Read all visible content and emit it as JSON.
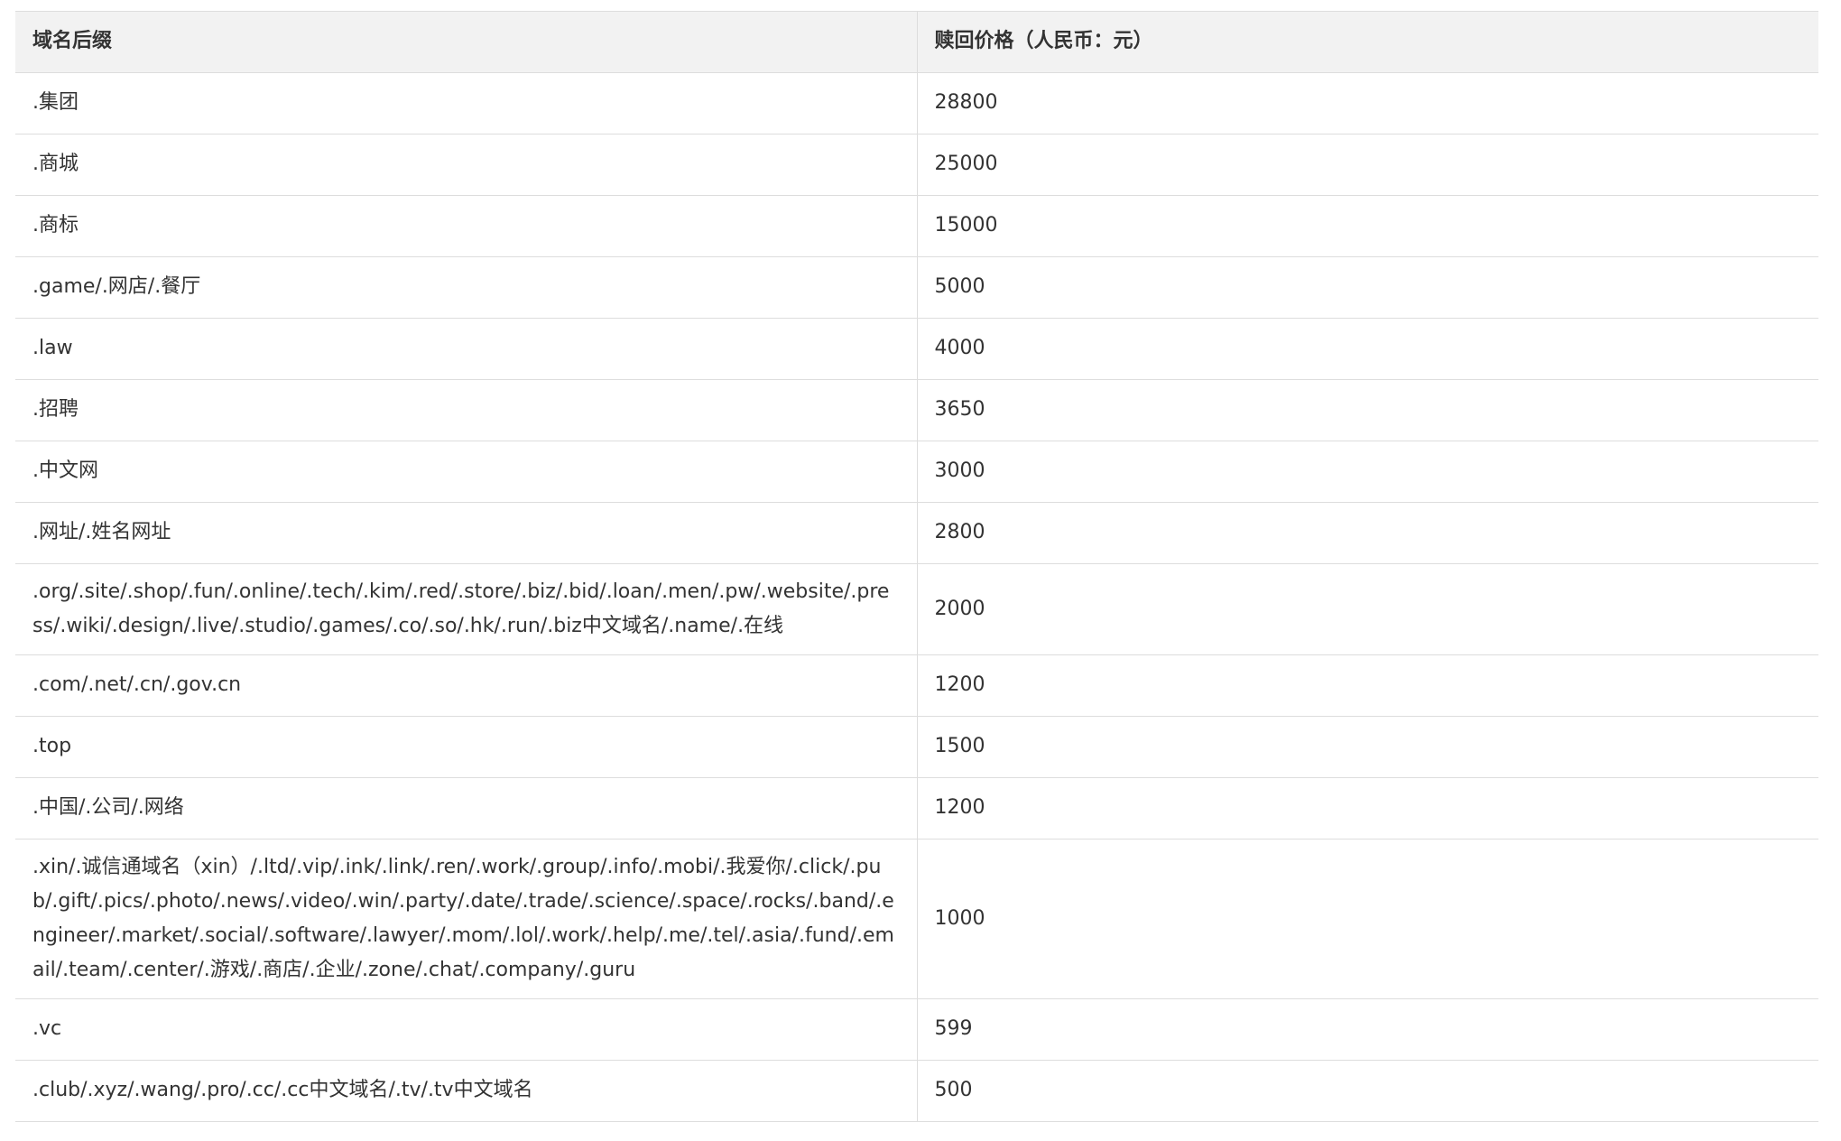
{
  "table": {
    "headers": [
      "域名后缀",
      "赎回价格（人民币：元）"
    ],
    "rows": [
      {
        "suffix": ".集团",
        "price": "28800"
      },
      {
        "suffix": ".商城",
        "price": "25000"
      },
      {
        "suffix": ".商标",
        "price": "15000"
      },
      {
        "suffix": ".game/.网店/.餐厅",
        "price": "5000"
      },
      {
        "suffix": ".law",
        "price": "4000"
      },
      {
        "suffix": ".招聘",
        "price": "3650"
      },
      {
        "suffix": ".中文网",
        "price": "3000"
      },
      {
        "suffix": ".网址/.姓名网址",
        "price": "2800"
      },
      {
        "suffix": ".org/.site/.shop/.fun/.online/.tech/.kim/.red/.store/.biz/.bid/.loan/.men/.pw/.website/.press/.wiki/.design/.live/.studio/.games/.co/.so/.hk/.run/.biz中文域名/.name/.在线",
        "price": "2000"
      },
      {
        "suffix": ".com/.net/.cn/.gov.cn",
        "price": "1200"
      },
      {
        "suffix": ".top",
        "price": "1500"
      },
      {
        "suffix": ".中国/.公司/.网络",
        "price": "1200"
      },
      {
        "suffix": ".xin/.诚信通域名（xin）/.ltd/.vip/.ink/.link/.ren/.work/.group/.info/.mobi/.我爱你/.click/.pub/.gift/.pics/.photo/.news/.video/.win/.party/.date/.trade/.science/.space/.rocks/.band/.engineer/.market/.social/.software/.lawyer/.mom/.lol/.work/.help/.me/.tel/.asia/.fund/.email/.team/.center/.游戏/.商店/.企业/.zone/.chat/.company/.guru",
        "price": "1000"
      },
      {
        "suffix": ".vc",
        "price": "599"
      },
      {
        "suffix": ".club/.xyz/.wang/.pro/.cc/.cc中文域名/.tv/.tv中文域名",
        "price": "500"
      }
    ]
  }
}
